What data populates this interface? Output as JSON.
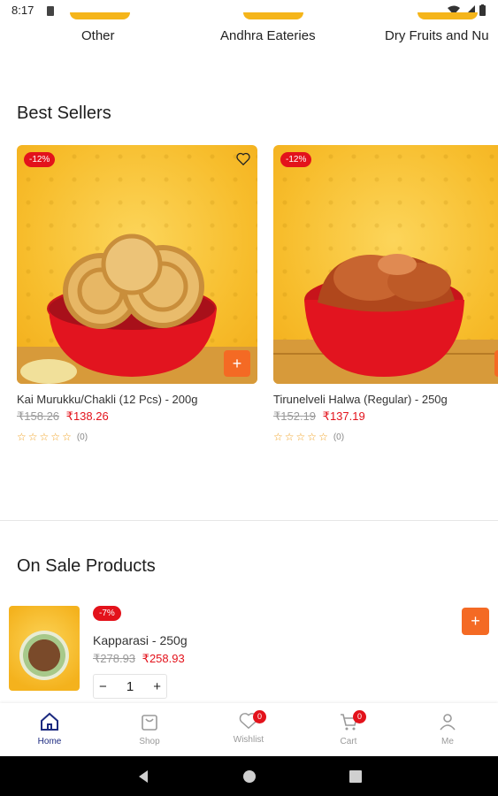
{
  "status_bar": {
    "time": "8:17"
  },
  "categories": [
    {
      "label": "Other"
    },
    {
      "label": "Andhra Eateries"
    },
    {
      "label": "Dry Fruits and Nu"
    }
  ],
  "best_sellers": {
    "title": "Best Sellers",
    "products": [
      {
        "discount": "-12%",
        "name": "Kai Murukku/Chakli (12 Pcs) -   200g",
        "old_price": "₹158.26",
        "new_price": "₹138.26",
        "reviews": "(0)"
      },
      {
        "discount": "-12%",
        "name": "Tirunelveli Halwa (Regular) -   250g",
        "old_price": "₹152.19",
        "new_price": "₹137.19",
        "reviews": "(0)"
      }
    ]
  },
  "on_sale": {
    "title": "On Sale Products",
    "item": {
      "discount": "-7%",
      "name": "Kapparasi -   250g",
      "old_price": "₹278.93",
      "new_price": "₹258.93",
      "quantity": "1"
    }
  },
  "bottom_nav": {
    "items": [
      {
        "label": "Home",
        "icon": "home-icon",
        "active": true
      },
      {
        "label": "Shop",
        "icon": "bag-icon",
        "active": false
      },
      {
        "label": "Wishlist",
        "icon": "heart-icon",
        "badge": "0"
      },
      {
        "label": "Cart",
        "icon": "cart-icon",
        "badge": "0"
      },
      {
        "label": "Me",
        "icon": "person-icon"
      }
    ]
  },
  "colors": {
    "accent": "#f46a24",
    "sale_red": "#e3121b",
    "nav_active": "#1c2a80",
    "card_yellow": "#f7bd2c"
  }
}
